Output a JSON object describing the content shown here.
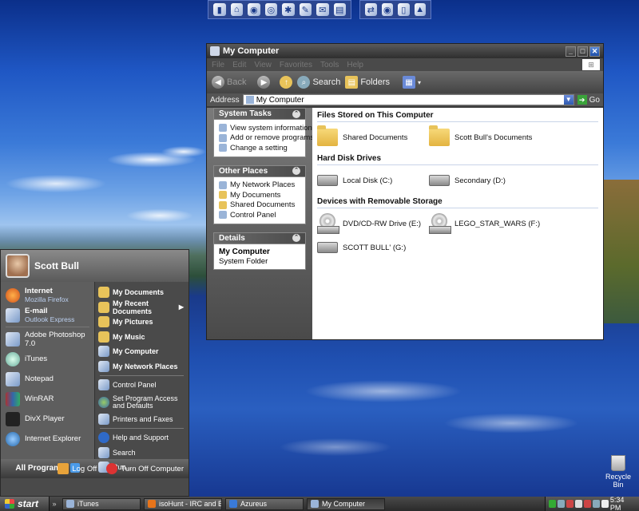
{
  "window": {
    "title": "My Computer",
    "menu": [
      "File",
      "Edit",
      "View",
      "Favorites",
      "Tools",
      "Help"
    ],
    "toolbar": {
      "back": "Back",
      "search": "Search",
      "folders": "Folders"
    },
    "address_label": "Address",
    "address_value": "My Computer",
    "go": "Go"
  },
  "tasks": {
    "system": {
      "title": "System Tasks",
      "items": [
        "View system information",
        "Add or remove programs",
        "Change a setting"
      ]
    },
    "other": {
      "title": "Other Places",
      "items": [
        "My Network Places",
        "My Documents",
        "Shared Documents",
        "Control Panel"
      ]
    },
    "details": {
      "title": "Details",
      "name": "My Computer",
      "type": "System Folder"
    }
  },
  "groups": {
    "files": {
      "title": "Files Stored on This Computer",
      "items": [
        "Shared Documents",
        "Scott Bull's Documents"
      ]
    },
    "disks": {
      "title": "Hard Disk Drives",
      "items": [
        "Local Disk (C:)",
        "Secondary (D:)"
      ]
    },
    "removable": {
      "title": "Devices with Removable Storage",
      "items": [
        "DVD/CD-RW Drive (E:)",
        "LEGO_STAR_WARS (F:)",
        "SCOTT BULL' (G:)"
      ]
    }
  },
  "start_menu": {
    "user": "Scott Bull",
    "internet": {
      "label": "Internet",
      "sub": "Mozilla Firefox"
    },
    "email": {
      "label": "E-mail",
      "sub": "Outlook Express"
    },
    "recent": [
      "Adobe Photoshop 7.0",
      "iTunes",
      "Notepad",
      "WinRAR",
      "DivX Player",
      "Internet Explorer"
    ],
    "all_programs": "All Programs",
    "right": [
      "My Documents",
      "My Recent Documents",
      "My Pictures",
      "My Music",
      "My Computer",
      "My Network Places"
    ],
    "right2": [
      "Control Panel",
      "Set Program Access and Defaults",
      "Printers and Faxes"
    ],
    "right3": [
      "Help and Support",
      "Search",
      "Run..."
    ],
    "log_off": "Log Off",
    "turn_off": "Turn Off Computer"
  },
  "taskbar": {
    "start": "start",
    "buttons": [
      "iTunes",
      "isoHunt - IRC and Bit ...",
      "Azureus",
      "My Computer"
    ],
    "clock": "5:34 PM"
  },
  "desktop": {
    "recycle_bin": "Recycle Bin"
  }
}
